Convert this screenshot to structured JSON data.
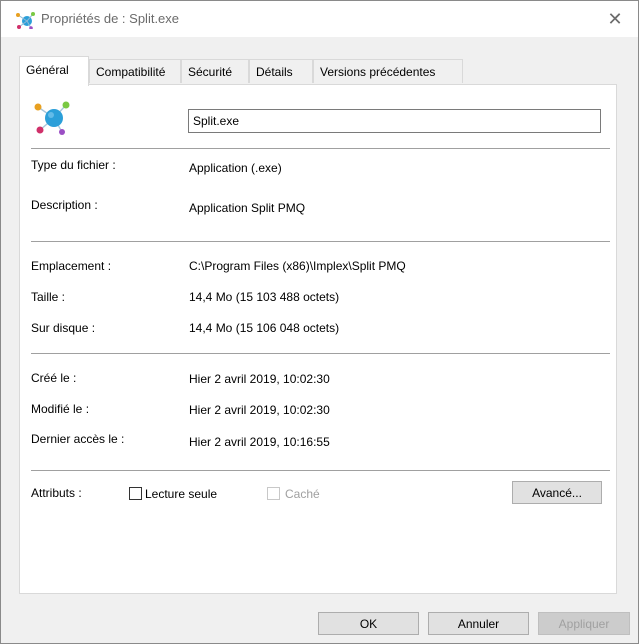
{
  "window": {
    "title": "Propriétés de : Split.exe",
    "close_glyph": "✕",
    "accent_color": "#2b9fd9"
  },
  "tabs": [
    {
      "label": "Général",
      "active": true
    },
    {
      "label": "Compatibilité",
      "active": false
    },
    {
      "label": "Sécurité",
      "active": false
    },
    {
      "label": "Détails",
      "active": false
    },
    {
      "label": "Versions précédentes",
      "active": false
    }
  ],
  "general": {
    "file_name": "Split.exe",
    "file_type": {
      "label": "Type du fichier :",
      "value": "Application (.exe)"
    },
    "description": {
      "label": "Description :",
      "value": "Application Split PMQ"
    },
    "location": {
      "label": "Emplacement :",
      "value": "C:\\Program Files (x86)\\Implex\\Split PMQ"
    },
    "size": {
      "label": "Taille :",
      "value": "14,4 Mo (15 103 488 octets)"
    },
    "size_on_disk": {
      "label": "Sur disque :",
      "value": "14,4 Mo (15 106 048 octets)"
    },
    "created": {
      "label": "Créé le :",
      "value": "Hier 2 avril 2019, 10:02:30"
    },
    "modified": {
      "label": "Modifié le :",
      "value": "Hier 2 avril 2019, 10:02:30"
    },
    "accessed": {
      "label": "Dernier accès le :",
      "value": "Hier 2 avril 2019, 10:16:55"
    },
    "attributes": {
      "label": "Attributs :",
      "read_only": {
        "label": "Lecture seule",
        "checked": false
      },
      "hidden": {
        "label": "Caché",
        "checked": false,
        "enabled": false
      },
      "advanced_button": "Avancé..."
    }
  },
  "footer": {
    "ok": "OK",
    "cancel": "Annuler",
    "apply": "Appliquer"
  }
}
